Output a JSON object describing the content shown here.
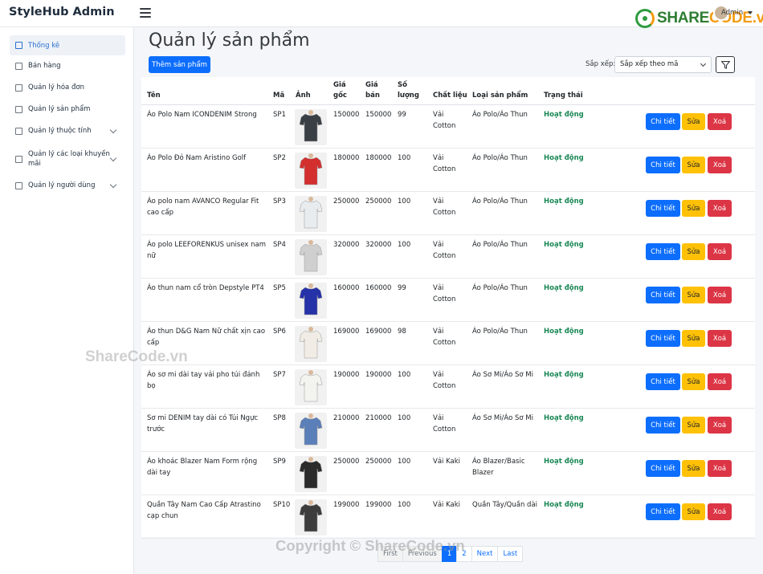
{
  "app": {
    "brand": "StyleHub Admin",
    "admin_name": "Admin"
  },
  "logo": {
    "text_main": "SHARE",
    "text_accent": "CODE.vn"
  },
  "sidebar": {
    "items": [
      {
        "label": "Thống kê",
        "icon": "chart-icon",
        "active": true,
        "expandable": false
      },
      {
        "label": "Bán hàng",
        "icon": "cart-icon",
        "active": false,
        "expandable": false
      },
      {
        "label": "Quản lý hóa đơn",
        "icon": "invoice-icon",
        "active": false,
        "expandable": false
      },
      {
        "label": "Quản lý sản phẩm",
        "icon": "product-icon",
        "active": false,
        "expandable": false
      },
      {
        "label": "Quản lý thuộc tính",
        "icon": "attribute-icon",
        "active": false,
        "expandable": true
      },
      {
        "label": "Quản lý các loại khuyến mãi",
        "icon": "promotion-icon",
        "active": false,
        "expandable": true
      },
      {
        "label": "Quản lý người dùng",
        "icon": "user-icon",
        "active": false,
        "expandable": true
      }
    ]
  },
  "main": {
    "title": "Quản lý sản phẩm",
    "add_button": "Thêm sản phẩm",
    "sort_label": "Sắp xếp:",
    "sort_value": "Sắp xếp theo mã"
  },
  "table": {
    "headers": {
      "name": "Tên",
      "code": "Mã",
      "image": "Ảnh",
      "price_original": "Giá gốc",
      "price_sale": "Giá bán",
      "quantity": "Số lượng",
      "material": "Chất liệu",
      "category": "Loại sản phẩm",
      "status": "Trạng thái"
    },
    "actions": {
      "detail": "Chi tiết",
      "edit": "Sửa",
      "delete": "Xoá"
    },
    "rows": [
      {
        "name": "Áo Polo Nam ICONDENIM Strong",
        "code": "SP1",
        "price_original": "150000",
        "price_sale": "150000",
        "quantity": "99",
        "material": "Vải Cotton",
        "category": "Áo Polo/Áo Thun",
        "status": "Hoạt động",
        "image_color": "#3a3f46"
      },
      {
        "name": "Áo Polo Đỏ Nam Aristino Golf",
        "code": "SP2",
        "price_original": "180000",
        "price_sale": "180000",
        "quantity": "100",
        "material": "Vải Cotton",
        "category": "Áo Polo/Áo Thun",
        "status": "Hoạt động",
        "image_color": "#d32f2f"
      },
      {
        "name": "Áo polo nam AVANCO Regular Fit cao cấp",
        "code": "SP3",
        "price_original": "250000",
        "price_sale": "250000",
        "quantity": "100",
        "material": "Vải Cotton",
        "category": "Áo Polo/Áo Thun",
        "status": "Hoạt động",
        "image_color": "#e9ecef"
      },
      {
        "name": "Áo polo LEEFORENKUS unisex nam nữ",
        "code": "SP4",
        "price_original": "320000",
        "price_sale": "320000",
        "quantity": "100",
        "material": "Vải Cotton",
        "category": "Áo Polo/Áo Thun",
        "status": "Hoạt động",
        "image_color": "#cfcfcf"
      },
      {
        "name": "Áo thun nam cổ tròn Depstyle PT4",
        "code": "SP5",
        "price_original": "160000",
        "price_sale": "160000",
        "quantity": "99",
        "material": "Vải Cotton",
        "category": "Áo Polo/Áo Thun",
        "status": "Hoạt động",
        "image_color": "#2632a8"
      },
      {
        "name": "Áo thun D&G Nam Nữ chất xịn cao cấp",
        "code": "SP6",
        "price_original": "169000",
        "price_sale": "169000",
        "quantity": "98",
        "material": "Vải Cotton",
        "category": "Áo Polo/Áo Thun",
        "status": "Hoạt động",
        "image_color": "#f1ede6"
      },
      {
        "name": "Áo sơ mi dài tay vải pho túi đánh bọ",
        "code": "SP7",
        "price_original": "190000",
        "price_sale": "190000",
        "quantity": "100",
        "material": "Vải Cotton",
        "category": "Áo Sơ Mi/Áo Sơ Mi",
        "status": "Hoạt động",
        "image_color": "#f3f3f0"
      },
      {
        "name": "Sơ mi DENIM tay dài có Túi Ngực trước",
        "code": "SP8",
        "price_original": "210000",
        "price_sale": "210000",
        "quantity": "100",
        "material": "Vải Cotton",
        "category": "Áo Sơ Mi/Áo Sơ Mi",
        "status": "Hoạt động",
        "image_color": "#5b7fb8"
      },
      {
        "name": "Áo khoác Blazer Nam Form rộng dài tay",
        "code": "SP9",
        "price_original": "250000",
        "price_sale": "250000",
        "quantity": "100",
        "material": "Vải Kaki",
        "category": "Áo Blazer/Basic Blazer",
        "status": "Hoạt động",
        "image_color": "#2b2b2b"
      },
      {
        "name": "Quần Tây Nam Cao Cấp Atrastino cạp chun",
        "code": "SP10",
        "price_original": "199000",
        "price_sale": "199000",
        "quantity": "100",
        "material": "Vải Kaki",
        "category": "Quần Tây/Quần dài",
        "status": "Hoạt động",
        "image_color": "#3d3d3d"
      }
    ]
  },
  "pagination": {
    "first": "First",
    "previous": "Previous",
    "pages": [
      "1",
      "2"
    ],
    "current": "1",
    "next": "Next",
    "last": "Last"
  },
  "watermarks": {
    "middle": "ShareCode.vn",
    "bottom": "Copyright © ShareCode.vn"
  },
  "colors": {
    "primary": "#0d6efd",
    "warning": "#ffc107",
    "danger": "#dc3545",
    "success": "#198754"
  }
}
